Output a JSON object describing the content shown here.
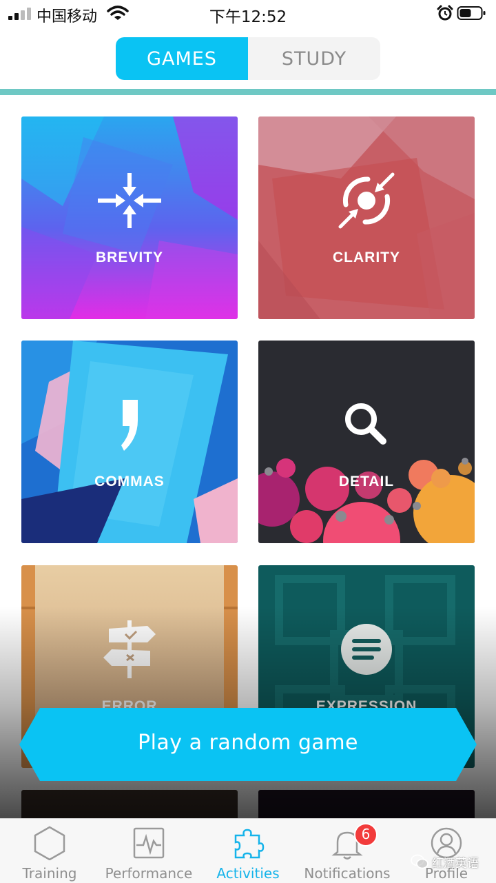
{
  "status_bar": {
    "carrier": "中国移动",
    "time": "下午12:52"
  },
  "header": {
    "tabs": [
      {
        "label": "GAMES",
        "selected": true
      },
      {
        "label": "STUDY",
        "selected": false
      }
    ]
  },
  "games": [
    {
      "label": "BREVITY",
      "icon": "compress-arrows-icon"
    },
    {
      "label": "CLARITY",
      "icon": "focus-arrows-icon"
    },
    {
      "label": "COMMAS",
      "icon": "comma-icon"
    },
    {
      "label": "DETAIL",
      "icon": "magnifier-icon"
    },
    {
      "label": "ERROR",
      "icon": "signpost-icon"
    },
    {
      "label": "EXPRESSION",
      "icon": "text-lines-icon"
    }
  ],
  "random_game": {
    "label": "Play a random game"
  },
  "tab_bar": {
    "items": [
      {
        "label": "Training",
        "icon": "hexagon-icon"
      },
      {
        "label": "Performance",
        "icon": "pulse-chart-icon"
      },
      {
        "label": "Activities",
        "icon": "puzzle-piece-icon",
        "active": true
      },
      {
        "label": "Notifications",
        "icon": "bell-icon",
        "badge": "6"
      },
      {
        "label": "Profile",
        "icon": "user-icon"
      }
    ]
  },
  "watermark": {
    "text": "红酒英语"
  },
  "colors": {
    "accent": "#0ac3f3",
    "active_tab": "#14b3ea",
    "header_rule": "#6ec8c4",
    "badge": "#f23b3b"
  }
}
